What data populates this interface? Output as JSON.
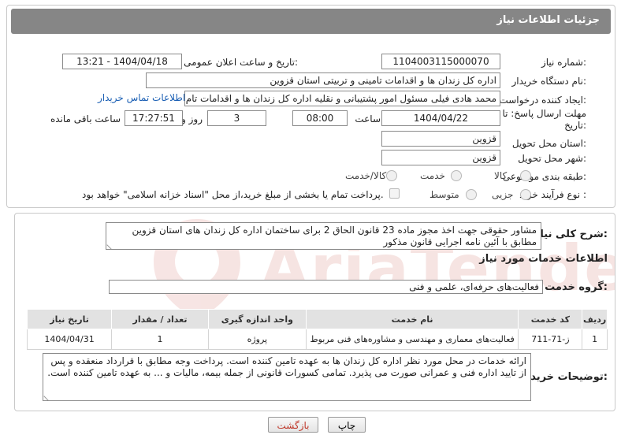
{
  "header": {
    "title": "جزئیات اطلاعات نیاز"
  },
  "form": {
    "need_number": {
      "label": "شماره نیاز:",
      "value": "1104003115000070"
    },
    "announce_datetime": {
      "label": "تاریخ و ساعت اعلان عمومی:",
      "value": "1404/04/18 - 13:21"
    },
    "buyer_org": {
      "label": "نام دستگاه خریدار:",
      "value": "اداره کل زندان ها و اقدامات تامینی و تربیتی استان قزوین"
    },
    "requester": {
      "label": "ایجاد کننده درخواست:",
      "value": "محمد هادی فیلی مسئول امور پشتیبانی و نقلیه اداره کل زندان ها و اقدامات تام",
      "contact_link": "اطلاعات تماس خریدار"
    },
    "deadline": {
      "label_line1": "مهلت ارسال پاسخ: تا",
      "label_line2": "تاریخ:",
      "date": "1404/04/22",
      "time_label": "ساعت",
      "time": "08:00",
      "days": "3",
      "days_label": "روز و",
      "remaining": "17:27:51",
      "remaining_label": "ساعت باقی مانده"
    },
    "delivery_province": {
      "label": "استان محل تحویل:",
      "value": "قزوین"
    },
    "delivery_city": {
      "label": "شهر محل تحویل:",
      "value": "قزوین"
    },
    "category": {
      "label": "طبقه بندی موضوعی:",
      "options": [
        "کالا",
        "خدمت",
        "کالا/خدمت"
      ]
    },
    "process_type": {
      "label": "نوع فرآیند خرید :",
      "options": [
        "جزیی",
        "متوسط"
      ],
      "note": "پرداخت تمام یا بخشی از مبلغ خرید،از محل \"اسناد خزانه اسلامی\" خواهد بود."
    }
  },
  "summary": {
    "label": "شرح کلی نیاز:",
    "text": "مشاور حقوقی جهت اخذ مجوز ماده 23 قانون الحاق 2 برای ساختمان اداره کل زندان های استان قزوین مطابق با آئین نامه اجرایی قانون مذکور"
  },
  "services": {
    "section_title": "اطلاعات خدمات مورد نیاز",
    "group_label": "گروه خدمت:",
    "group_value": "فعالیت‌های حرفه‌ای، علمی و فنی",
    "columns": [
      "ردیف",
      "کد خدمت",
      "نام خدمت",
      "واحد اندازه گیری",
      "تعداد / مقدار",
      "تاریخ نیاز"
    ],
    "rows": [
      [
        "1",
        "ز-71-711",
        "فعالیت‌های معماری و مهندسی و مشاوره‌های فنی مربوط",
        "پروژه",
        "1",
        "1404/04/31"
      ]
    ]
  },
  "buyer_notes": {
    "label": "توضیحات خریدار:",
    "text": "ارائه خدمات در محل مورد نظر اداره کل زندان ها به عهده تامین کننده است. پرداخت وجه مطابق با قرارداد منعقده و پس از تایید اداره فنی و عمرانی صورت می پذیرد. تمامی کسورات قانونی از جمله بیمه، مالیات و ... به عهده تامین کننده است."
  },
  "buttons": {
    "print": "چاپ",
    "back": "بازگشت"
  },
  "colors": {
    "header_bg": "#868686",
    "link": "#1a5fb4",
    "back_text": "#c0392b"
  }
}
